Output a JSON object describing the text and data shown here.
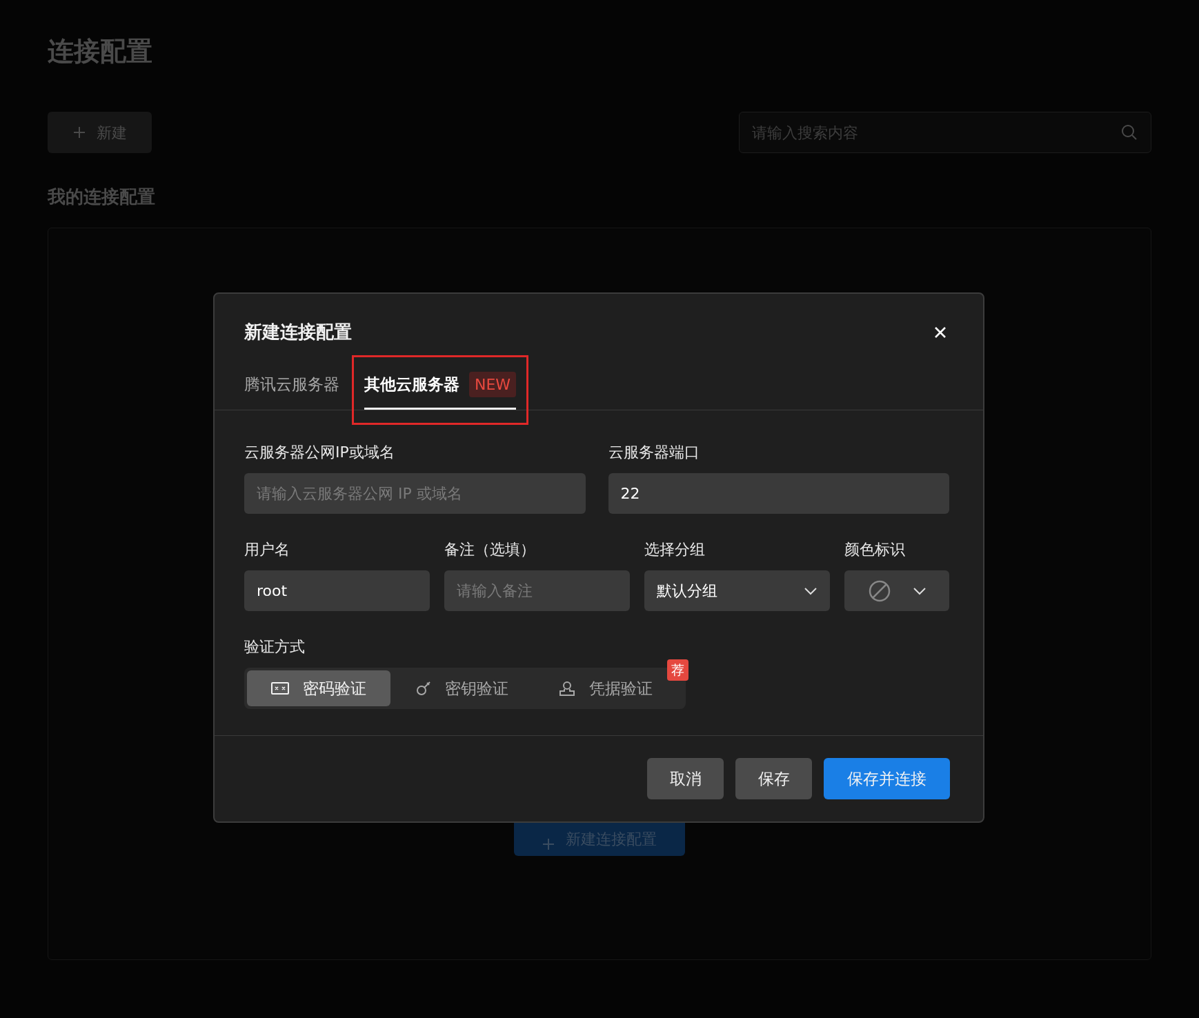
{
  "page": {
    "title": "连接配置",
    "new_button": "新建",
    "search": {
      "placeholder": "请输入搜索内容"
    },
    "section_title": "我的连接配置",
    "create_button": "新建连接配置"
  },
  "dialog": {
    "title": "新建连接配置",
    "tabs": [
      {
        "label": "腾讯云服务器",
        "selected": false,
        "highlighted": false
      },
      {
        "label": "其他云服务器",
        "badge": "NEW",
        "selected": true,
        "highlighted": true
      }
    ],
    "field_rows": [
      [
        {
          "label": "云服务器公网IP或域名",
          "placeholder": "请输入云服务器公网 IP 或域名",
          "kind": "input"
        },
        {
          "label": "云服务器端口",
          "value": "22",
          "kind": "input"
        }
      ],
      [
        {
          "label": "用户名",
          "value": "root",
          "kind": "input"
        },
        {
          "label": "备注（选填）",
          "placeholder": "请输入备注",
          "kind": "input"
        },
        {
          "label": "选择分组",
          "value": "默认分组",
          "kind": "select"
        },
        {
          "label": "颜色标识",
          "kind": "color"
        }
      ]
    ],
    "auth": {
      "label": "验证方式",
      "badge": "荐",
      "options": [
        {
          "label": "密码验证",
          "kind": "password",
          "selected": true
        },
        {
          "label": "密钥验证",
          "kind": "key",
          "selected": false
        },
        {
          "label": "凭据验证",
          "kind": "person",
          "selected": false
        }
      ]
    },
    "buttons": [
      {
        "label": "取消",
        "kind": "secondary"
      },
      {
        "label": "保存",
        "kind": "secondary"
      },
      {
        "label": "保存并连接",
        "kind": "primary"
      }
    ]
  }
}
